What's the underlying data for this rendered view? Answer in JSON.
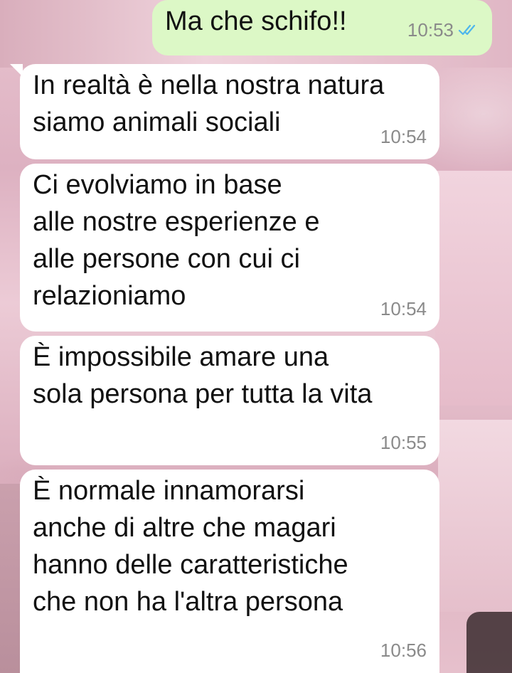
{
  "chat": {
    "messages": [
      {
        "direction": "outgoing",
        "text": "Ma che schifo!!",
        "time": "10:53",
        "status": "read"
      },
      {
        "direction": "incoming",
        "text": "In realtà è nella nostra natura\nsiamo animali sociali",
        "time": "10:54"
      },
      {
        "direction": "incoming",
        "text": "Ci evolviamo in base\nalle nostre esperienze e\nalle persone con cui ci\nrelazioniamo",
        "time": "10:54"
      },
      {
        "direction": "incoming",
        "text": "È impossibile amare una\nsola persona per tutta la vita",
        "time": "10:55"
      },
      {
        "direction": "incoming",
        "text": "È normale innamorarsi\nanche di altre che magari\nhanno delle caratteristiche\nche non ha l'altra persona",
        "time": "10:56"
      }
    ]
  },
  "colors": {
    "outgoing_bubble": "#dcf8c6",
    "incoming_bubble": "#ffffff",
    "read_ticks": "#4fb6ec",
    "timestamp": "#8a8a8a"
  },
  "icons": {
    "read_receipt": "double-check-icon"
  }
}
